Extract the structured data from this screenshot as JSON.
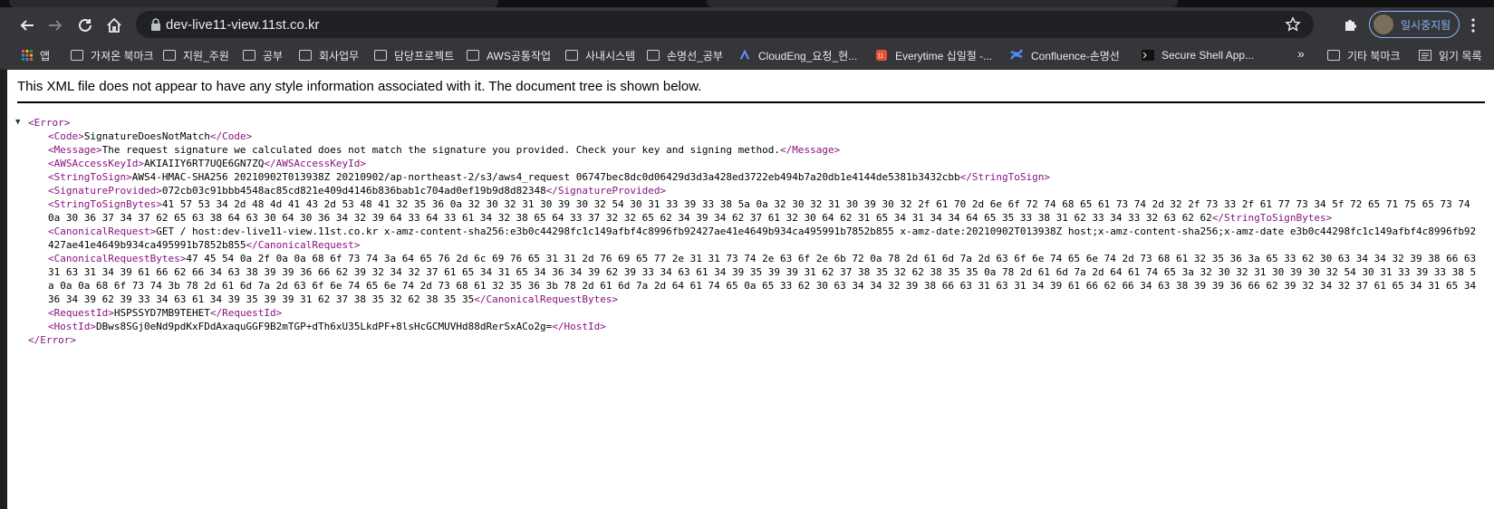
{
  "browser": {
    "url": "dev-live11-view.11st.co.kr",
    "profile_label": "일시중지됨",
    "bookmarks_overflow": "»",
    "bookmarks": [
      {
        "label": "앱",
        "icon": "apps-grid-icon"
      },
      {
        "label": "가져온 북마크",
        "icon": "folder-icon"
      },
      {
        "label": "지원_주원",
        "icon": "folder-icon"
      },
      {
        "label": "공부",
        "icon": "folder-icon"
      },
      {
        "label": "회사업무",
        "icon": "folder-icon"
      },
      {
        "label": "담당프로젝트",
        "icon": "folder-icon"
      },
      {
        "label": "AWS공통작업",
        "icon": "folder-icon"
      },
      {
        "label": "사내시스템",
        "icon": "folder-icon"
      },
      {
        "label": "손명선_공부",
        "icon": "folder-icon"
      },
      {
        "label": "CloudEng_요청_현...",
        "icon": "cloudeng-icon"
      },
      {
        "label": "Everytime 십일절 -...",
        "icon": "everytime-icon"
      },
      {
        "label": "Confluence-손명선",
        "icon": "confluence-icon"
      },
      {
        "label": "Secure Shell App...",
        "icon": "terminal-icon"
      },
      {
        "label": "기타 북마크",
        "icon": "folder-icon"
      },
      {
        "label": "읽기 목록",
        "icon": "reading-list-icon"
      }
    ]
  },
  "page": {
    "notice": "This XML file does not appear to have any style information associated with it. The document tree is shown below.",
    "root_open": "<Error>",
    "root_close": "</Error>",
    "toggle": "▼",
    "elements": [
      {
        "tag": "Code",
        "value": "SignatureDoesNotMatch"
      },
      {
        "tag": "Message",
        "value": "The request signature we calculated does not match the signature you provided. Check your key and signing method."
      },
      {
        "tag": "AWSAccessKeyId",
        "value": "AKIAIIY6RT7UQE6GN7ZQ"
      },
      {
        "tag": "StringToSign",
        "value": "AWS4-HMAC-SHA256 20210902T013938Z 20210902/ap-northeast-2/s3/aws4_request 06747bec8dc0d06429d3d3a428ed3722eb494b7a20db1e4144de5381b3432cbb"
      },
      {
        "tag": "SignatureProvided",
        "value": "072cb03c91bbb4548ac85cd821e409d4146b836bab1c704ad0ef19b9d8d82348"
      },
      {
        "tag": "StringToSignBytes",
        "value": "41 57 53 34 2d 48 4d 41 43 2d 53 48 41 32 35 36 0a 32 30 32 31 30 39 30 32 54 30 31 33 39 33 38 5a 0a 32 30 32 31 30 39 30 32 2f 61 70 2d 6e 6f 72 74 68 65 61 73 74 2d 32 2f 73 33 2f 61 77 73 34 5f 72 65 71 75 65 73 74 0a 30 36 37 34 37 62 65 63 38 64 63 30 64 30 36 34 32 39 64 33 64 33 61 34 32 38 65 64 33 37 32 32 65 62 34 39 34 62 37 61 32 30 64 62 31 65 34 31 34 34 64 65 35 33 38 31 62 33 34 33 32 63 62 62"
      },
      {
        "tag": "CanonicalRequest",
        "value": "GET / host:dev-live11-view.11st.co.kr x-amz-content-sha256:e3b0c44298fc1c149afbf4c8996fb92427ae41e4649b934ca495991b7852b855 x-amz-date:20210902T013938Z host;x-amz-content-sha256;x-amz-date e3b0c44298fc1c149afbf4c8996fb92427ae41e4649b934ca495991b7852b855"
      },
      {
        "tag": "CanonicalRequestBytes",
        "value": "47 45 54 0a 2f 0a 0a 68 6f 73 74 3a 64 65 76 2d 6c 69 76 65 31 31 2d 76 69 65 77 2e 31 31 73 74 2e 63 6f 2e 6b 72 0a 78 2d 61 6d 7a 2d 63 6f 6e 74 65 6e 74 2d 73 68 61 32 35 36 3a 65 33 62 30 63 34 34 32 39 38 66 63 31 63 31 34 39 61 66 62 66 34 63 38 39 39 36 66 62 39 32 34 32 37 61 65 34 31 65 34 36 34 39 62 39 33 34 63 61 34 39 35 39 39 31 62 37 38 35 32 62 38 35 35 0a 78 2d 61 6d 7a 2d 64 61 74 65 3a 32 30 32 31 30 39 30 32 54 30 31 33 39 33 38 5a 0a 0a 68 6f 73 74 3b 78 2d 61 6d 7a 2d 63 6f 6e 74 65 6e 74 2d 73 68 61 32 35 36 3b 78 2d 61 6d 7a 2d 64 61 74 65 0a 65 33 62 30 63 34 34 32 39 38 66 63 31 63 31 34 39 61 66 62 66 34 63 38 39 39 36 66 62 39 32 34 32 37 61 65 34 31 65 34 36 34 39 62 39 33 34 63 61 34 39 35 39 39 31 62 37 38 35 32 62 38 35 35"
      },
      {
        "tag": "RequestId",
        "value": "HSPSSYD7MB9TEHET"
      },
      {
        "tag": "HostId",
        "value": "DBws8SGj0eNd9pdKxFDdAxaquGGF9B2mTGP+dTh6xU35LkdPF+8lsHcGCMUVHd88dRerSxACo2g="
      }
    ]
  }
}
